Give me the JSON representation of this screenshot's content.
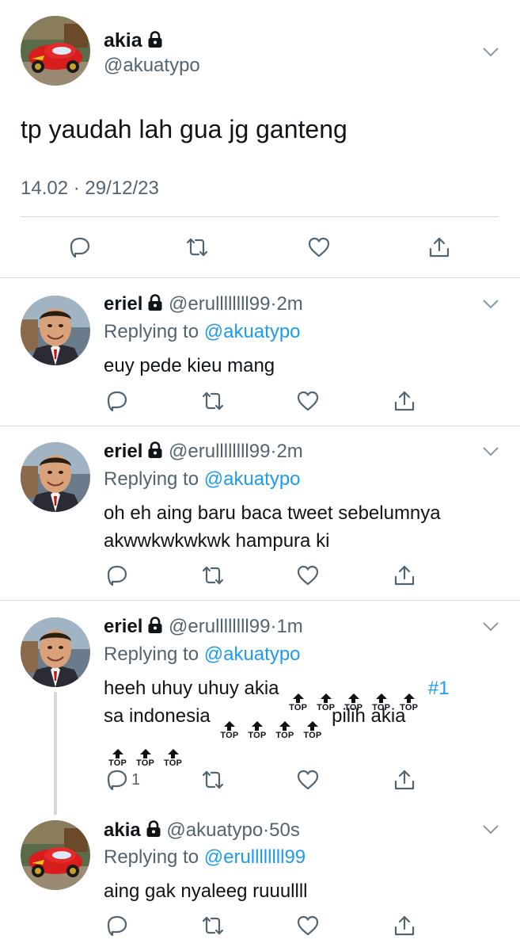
{
  "main_tweet": {
    "display_name": "akia",
    "handle": "@akuatypo",
    "text": "tp yaudah lah gua jg ganteng",
    "time": "14.02",
    "separator": "·",
    "date": "29/12/23"
  },
  "replies": [
    {
      "display_name": "eriel",
      "handle": "@erullllllll99",
      "separator": "·",
      "time": "2m",
      "replying_label": "Replying to",
      "replying_to": "@akuatypo",
      "line1": "euy pede kieu mang"
    },
    {
      "display_name": "eriel",
      "handle": "@erullllllll99",
      "separator": "·",
      "time": "2m",
      "replying_label": "Replying to",
      "replying_to": "@akuatypo",
      "line1": "oh eh aing baru baca tweet sebelumnya",
      "line2": "akwwkwkwkwk hampura ki"
    },
    {
      "display_name": "eriel",
      "handle": "@erullllllll99",
      "separator": "·",
      "time": "1m",
      "replying_label": "Replying to",
      "replying_to": "@akuatypo",
      "line1_a": "heeh uhuy uhuy akia",
      "hashtag": "#1",
      "line2_a": "sa indonesia",
      "line2_b": "pilih akia",
      "top_label": "TOP",
      "reply_count": "1"
    },
    {
      "display_name": "akia",
      "handle": "@akuatypo",
      "separator": "·",
      "time": "50s",
      "replying_label": "Replying to",
      "replying_to": "@erullllllll99",
      "line1": "aing gak nyaleeg ruuullll"
    }
  ],
  "colors": {
    "text": "#0f1419",
    "muted": "#536471",
    "link": "#1d9bf0",
    "divider": "#cfd9de",
    "thread_line": "#cfd9de"
  },
  "icons": [
    "lock-icon",
    "chevron-down-icon",
    "reply-icon",
    "retweet-icon",
    "like-icon",
    "share-icon"
  ]
}
